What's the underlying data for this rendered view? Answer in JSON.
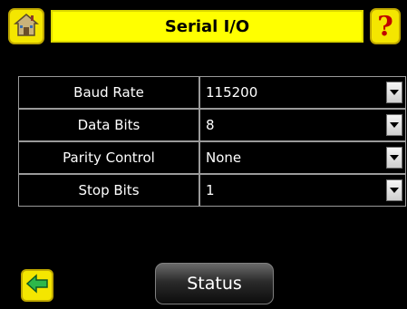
{
  "header": {
    "title": "Serial I/O",
    "home_icon": "home-icon",
    "help_icon": "help-icon",
    "help_glyph": "?"
  },
  "settings": [
    {
      "label": "Baud Rate",
      "value": "115200"
    },
    {
      "label": "Data Bits",
      "value": "8"
    },
    {
      "label": "Parity Control",
      "value": "None"
    },
    {
      "label": "Stop Bits",
      "value": "1"
    }
  ],
  "footer": {
    "back_icon": "back-arrow-icon",
    "status_label": "Status"
  },
  "colors": {
    "background": "#000000",
    "title_bar": "#ffff00",
    "button_yellow": "#f4e600",
    "border_gray": "#9a9a9a"
  }
}
